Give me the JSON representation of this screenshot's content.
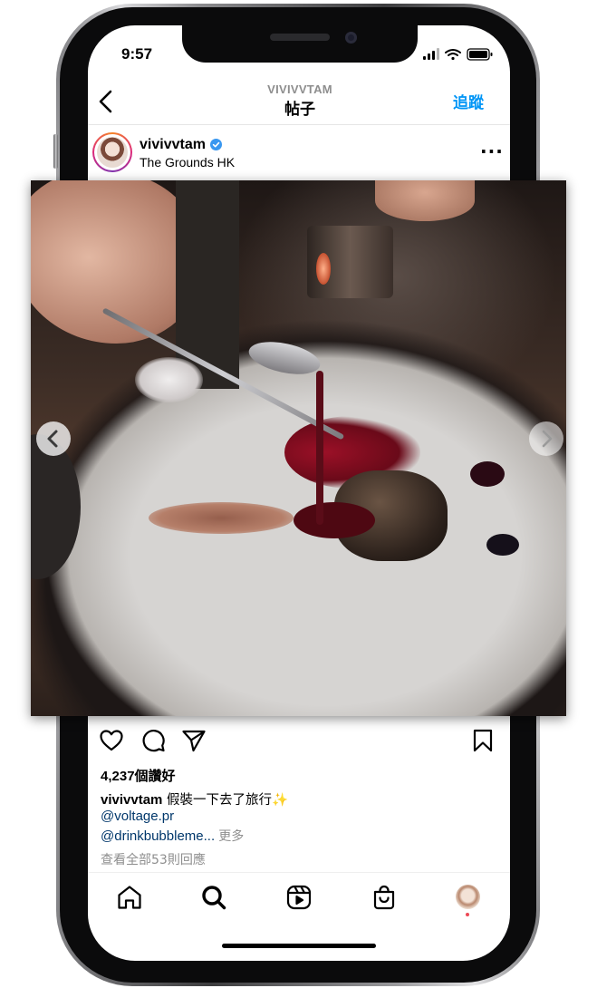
{
  "status_bar": {
    "time": "9:57",
    "icons": [
      "signal-icon",
      "wifi-icon",
      "battery-icon"
    ]
  },
  "header": {
    "subtitle": "VIVIVVTAM",
    "title": "帖子",
    "back_icon": "chevron-left-icon",
    "follow_label": "追蹤",
    "follow_color": "#0095f6"
  },
  "post": {
    "username": "vivivvtam",
    "verified": true,
    "location": "The Grounds HK",
    "more_label": "···",
    "photo": "plated dish with sauce being spooned over meat",
    "carousel_icons": [
      "chevron-left-icon",
      "chevron-right-icon"
    ]
  },
  "actions": {
    "icons": [
      "heart-icon",
      "comment-icon",
      "share-icon",
      "bookmark-icon"
    ],
    "likes_count": "4,237",
    "likes_suffix": "個讚好"
  },
  "caption": {
    "username": "vivivvtam",
    "text": "假裝一下去了旅行✨",
    "mention_1": "@voltage.pr",
    "mention_2": "@drinkbubbleme...",
    "more_label": "更多",
    "view_comments": "查看全部53則回應"
  },
  "tab_bar": {
    "icons": [
      "home-icon",
      "search-icon",
      "reels-icon",
      "shop-icon",
      "profile-avatar"
    ],
    "active": "search-icon"
  },
  "colors": {
    "link": "#00376b",
    "muted": "#8e8e8e",
    "notification": "#ed4956"
  }
}
